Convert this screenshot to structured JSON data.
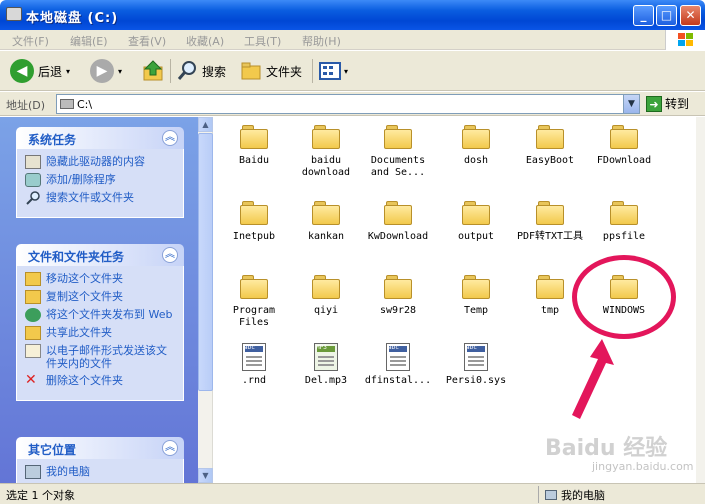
{
  "window": {
    "title": "本地磁盘 (C:)"
  },
  "menu": [
    "文件(F)",
    "编辑(E)",
    "查看(V)",
    "收藏(A)",
    "工具(T)",
    "帮助(H)"
  ],
  "toolbar": {
    "back": "后退",
    "search": "搜索",
    "folders": "文件夹"
  },
  "address": {
    "label": "地址(D)",
    "value": "C:\\",
    "go": "转到"
  },
  "panels": [
    {
      "title": "系统任务",
      "items": [
        "隐藏此驱动器的内容",
        "添加/删除程序",
        "搜索文件或文件夹"
      ]
    },
    {
      "title": "文件和文件夹任务",
      "items": [
        "移动这个文件夹",
        "复制这个文件夹",
        "将这个文件夹发布到 Web",
        "共享此文件夹",
        "以电子邮件形式发送该文件夹内的文件",
        "删除这个文件夹"
      ]
    },
    {
      "title": "其它位置",
      "items": [
        "我的电脑"
      ]
    }
  ],
  "items": [
    {
      "name": "Baidu",
      "kind": "folder"
    },
    {
      "name": "baidu download",
      "kind": "folder"
    },
    {
      "name": "Documents and Se...",
      "kind": "folder"
    },
    {
      "name": "dosh",
      "kind": "folder"
    },
    {
      "name": "EasyBoot",
      "kind": "folder"
    },
    {
      "name": "FDownload",
      "kind": "folder"
    },
    {
      "name": "Inetpub",
      "kind": "folder"
    },
    {
      "name": "kankan",
      "kind": "folder"
    },
    {
      "name": "KwDownload",
      "kind": "folder"
    },
    {
      "name": "output",
      "kind": "folder"
    },
    {
      "name": "PDF转TXT工具",
      "kind": "folder"
    },
    {
      "name": "ppsfile",
      "kind": "folder"
    },
    {
      "name": "Program Files",
      "kind": "folder"
    },
    {
      "name": "qiyi",
      "kind": "folder"
    },
    {
      "name": "sw9r28",
      "kind": "folder"
    },
    {
      "name": "Temp",
      "kind": "folder"
    },
    {
      "name": "tmp",
      "kind": "folder"
    },
    {
      "name": "WINDOWS",
      "kind": "folder"
    },
    {
      "name": ".rnd",
      "kind": "file"
    },
    {
      "name": "Del.mp3",
      "kind": "mp3"
    },
    {
      "name": "dfinstal...",
      "kind": "file"
    },
    {
      "name": "Persi0.sys",
      "kind": "file"
    }
  ],
  "status": {
    "left": "选定 1 个对象",
    "right": "我的电脑"
  },
  "watermark": {
    "brand": "Baidu 经验",
    "url": "jingyan.baidu.com"
  },
  "colors": {
    "title_bar": "#0a5de0",
    "panel_text": "#215dc6",
    "annotation": "#e3165b"
  }
}
